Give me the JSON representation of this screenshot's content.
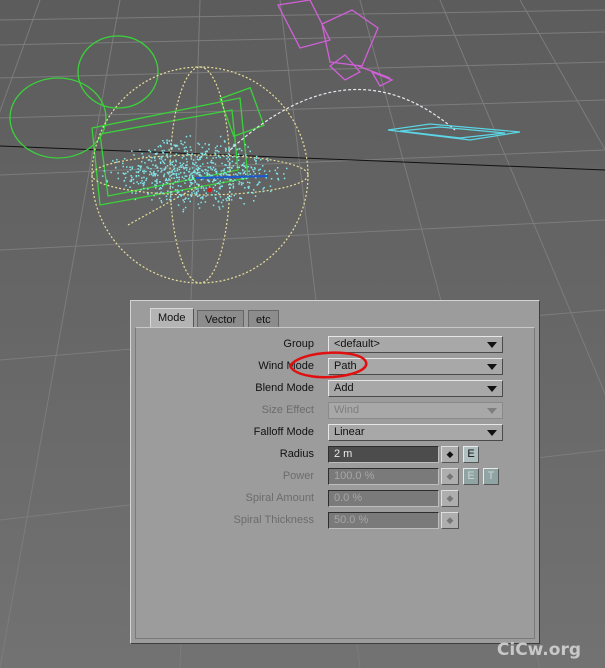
{
  "tabs": [
    "Mode",
    "Vector",
    "etc"
  ],
  "fields": {
    "group": {
      "label": "Group",
      "value": "<default>"
    },
    "wind_mode": {
      "label": "Wind Mode",
      "value": "Path"
    },
    "blend_mode": {
      "label": "Blend Mode",
      "value": "Add"
    },
    "size_effect": {
      "label": "Size Effect",
      "value": "Wind"
    },
    "falloff_mode": {
      "label": "Falloff Mode",
      "value": "Linear"
    },
    "radius": {
      "label": "Radius",
      "value": "2 m"
    },
    "power": {
      "label": "Power",
      "value": "100.0 %"
    },
    "spiral_amount": {
      "label": "Spiral Amount",
      "value": "0.0 %"
    },
    "spiral_thickness": {
      "label": "Spiral Thickness",
      "value": "50.0 %"
    }
  },
  "buttons": {
    "envelope": "E",
    "texture": "T",
    "spinner": "◆"
  },
  "annotation_color": "#e01010",
  "watermark": "CiCw.org"
}
